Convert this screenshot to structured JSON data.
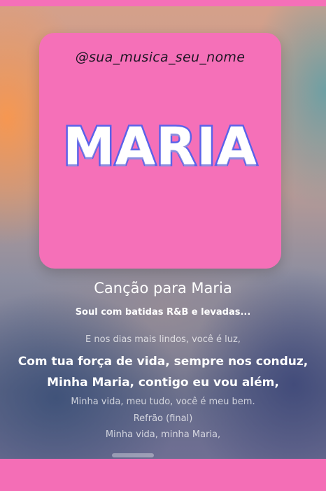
{
  "cover": {
    "handle": "@sua_musica_seu_nome",
    "title": "MARIA"
  },
  "song": {
    "title": "Canção para Maria",
    "subtitle": "Soul com batidas R&B e levadas..."
  },
  "lyrics": [
    {
      "text": "E nos dias mais lindos, você é luz,",
      "active": false
    },
    {
      "text": "Com tua força de vida, sempre nos conduz,",
      "active": true
    },
    {
      "text": "Minha Maria, contigo eu vou além,",
      "active": true
    },
    {
      "text": "Minha vida, meu tudo, você é meu bem.",
      "active": false
    },
    {
      "text": "Refrão (final)",
      "active": false
    },
    {
      "text": "Minha vida, minha Maria,",
      "active": false
    }
  ],
  "colors": {
    "brand_pink": "#f570b8",
    "title_stroke": "#5a62ea"
  }
}
